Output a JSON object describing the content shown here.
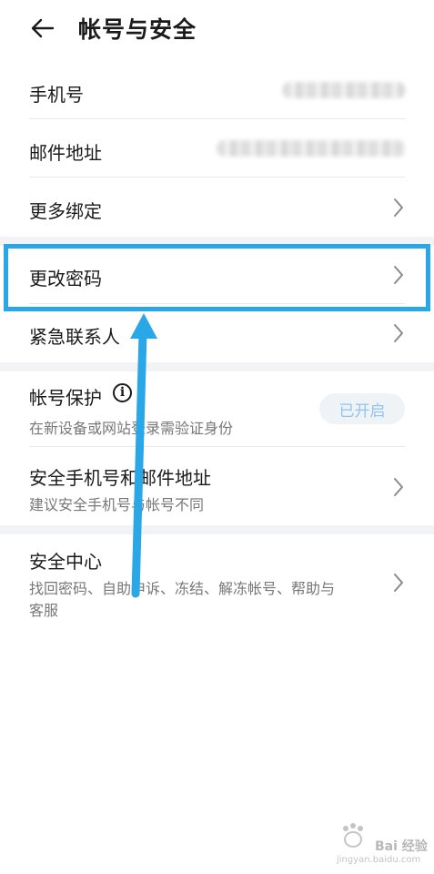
{
  "header": {
    "title": "帐号与安全",
    "back_icon": "arrow-left-icon"
  },
  "rows": {
    "phone": {
      "label": "手机号"
    },
    "email": {
      "label": "邮件地址"
    },
    "more_bind": {
      "label": "更多绑定"
    },
    "change_password": {
      "label": "更改密码"
    },
    "emergency_contact": {
      "label": "紧急联系人"
    },
    "account_protection": {
      "label": "帐号保护",
      "sub": "在新设备或网站登录需验证身份",
      "status": "已开启",
      "icon": "info-icon"
    },
    "secure_phone_email": {
      "label": "安全手机号和邮件地址",
      "sub": "建议安全手机号与帐号不同"
    },
    "security_center": {
      "label": "安全中心",
      "sub_line1": "找回密码、自助申诉、冻结、解冻帐号、帮助与",
      "sub_line2": "客服"
    }
  },
  "annotation": {
    "highlight_color": "#2aa7e6"
  },
  "watermark": {
    "text": "Bai 经验",
    "url": "jingyan.baidu.com"
  },
  "colors": {
    "accent": "#2aa7e6",
    "badge_text": "#8fc4ee",
    "section_gap": "#f1f3f5"
  }
}
